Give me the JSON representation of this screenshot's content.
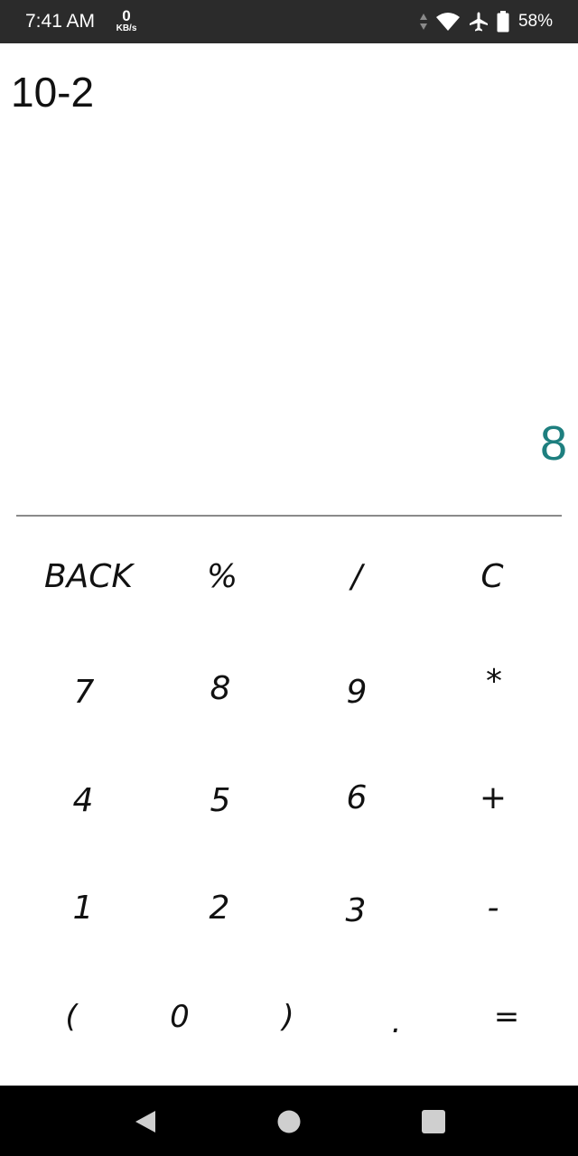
{
  "status_bar": {
    "time": "7:41 AM",
    "net_speed_value": "0",
    "net_speed_unit": "KB/s",
    "battery_percent": "58%",
    "icons": [
      "data-arrows-icon",
      "wifi-icon",
      "airplane-mode-icon",
      "battery-icon"
    ]
  },
  "display": {
    "expression": "10-2",
    "result": "8",
    "result_color": "#1e7f7f"
  },
  "keypad": {
    "row1": [
      "BACK",
      "%",
      "/",
      "C"
    ],
    "row2": [
      "7",
      "8",
      "9",
      "*"
    ],
    "row3": [
      "4",
      "5",
      "6",
      "+"
    ],
    "row4": [
      "1",
      "2",
      "3",
      "-"
    ],
    "row5": [
      "(",
      "0",
      ")",
      ".",
      "="
    ]
  },
  "nav_bar": {
    "icons": [
      "back-icon",
      "home-icon",
      "recents-icon"
    ]
  }
}
